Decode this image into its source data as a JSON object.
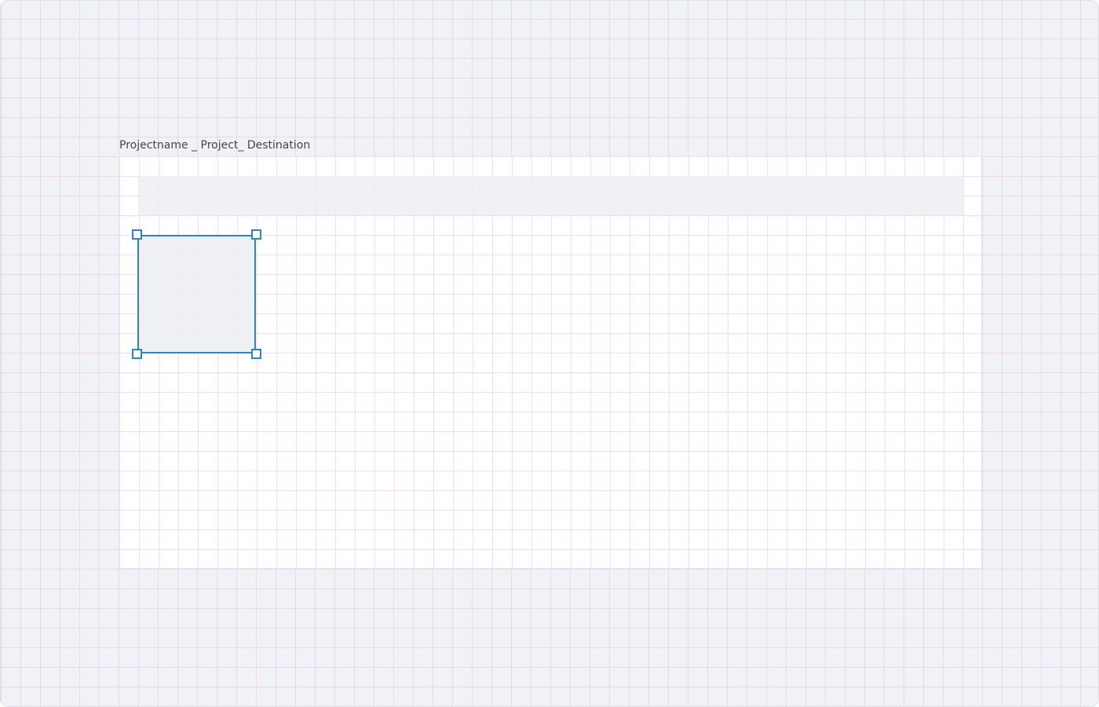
{
  "canvas": {
    "frame": {
      "label": "Projectname _ Project_ Destination"
    },
    "colors": {
      "background": "#f1f2f5",
      "grid_line": "#e2b4e2",
      "frame_fill": "#ffffff",
      "placeholder_fill": "#eceef2",
      "selection_accent": "#2f83cc"
    }
  }
}
